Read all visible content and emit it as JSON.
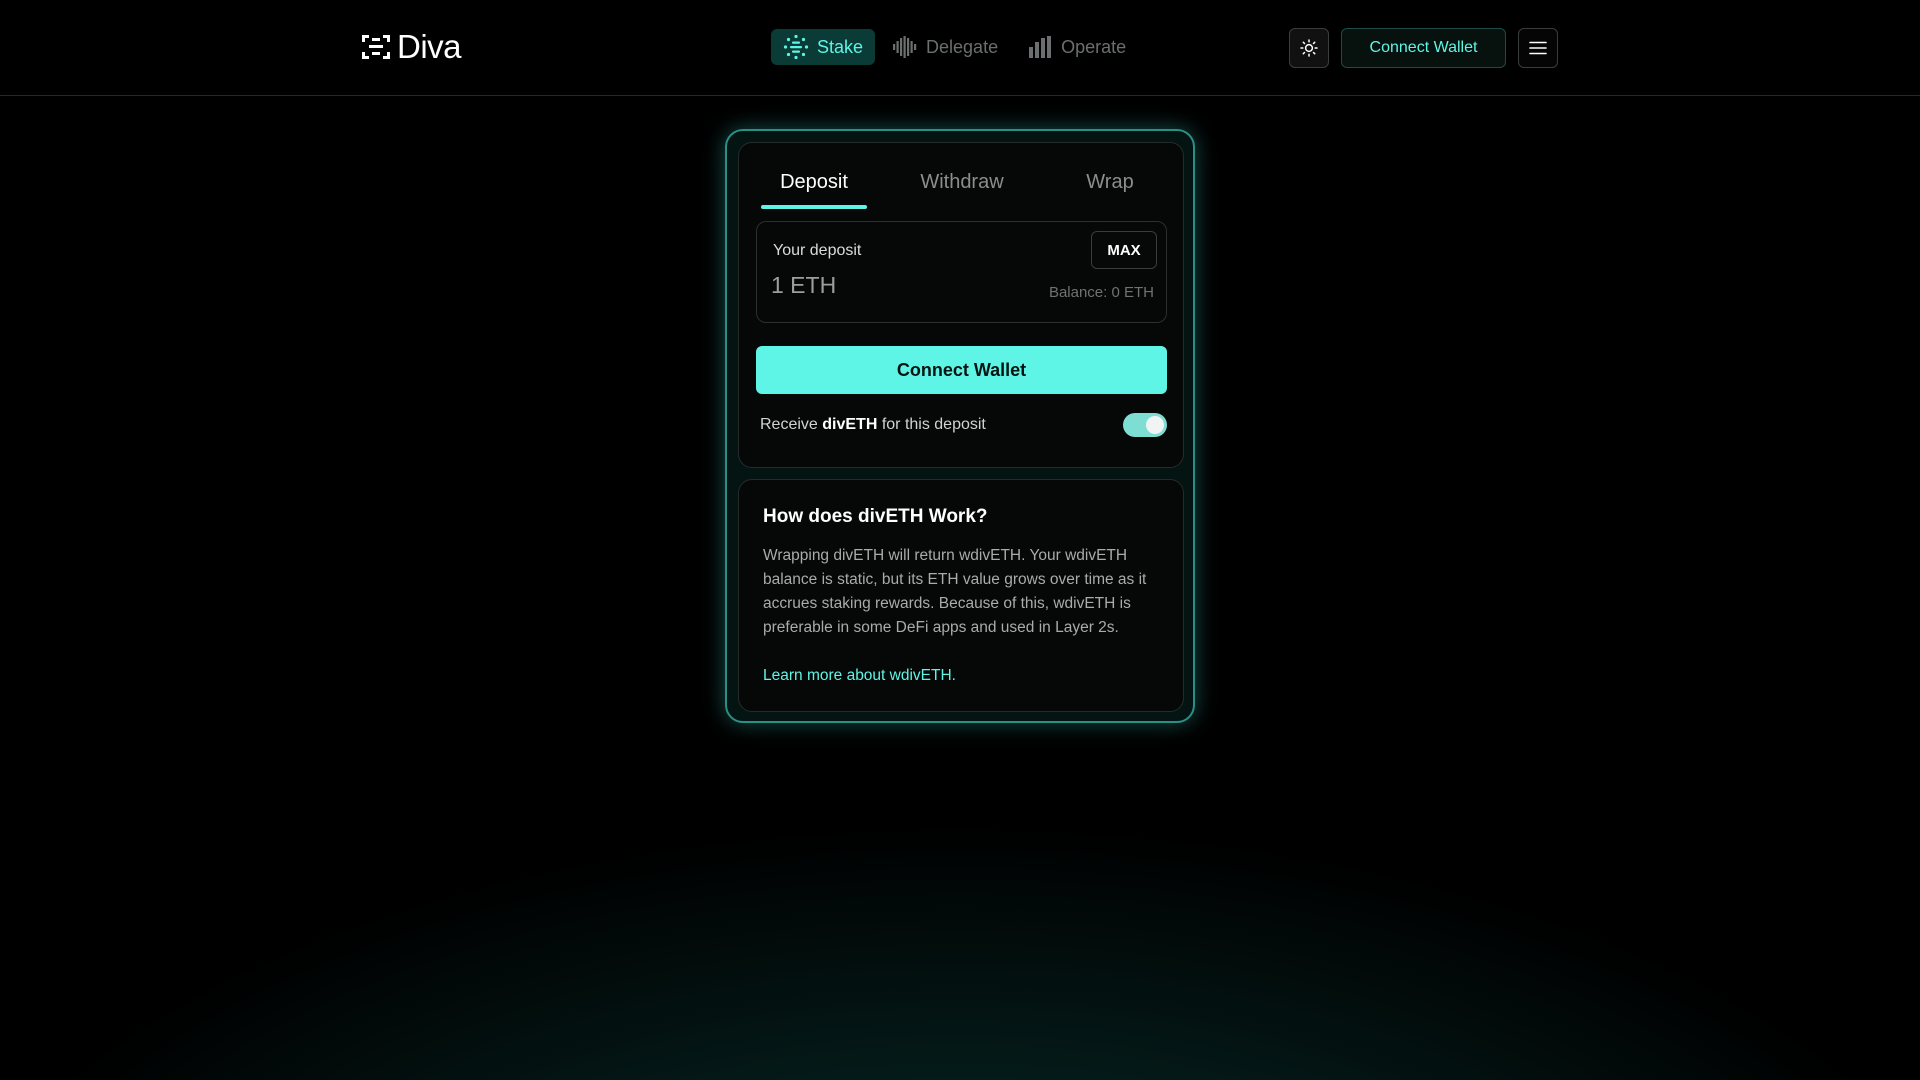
{
  "header": {
    "logo_text": "Diva",
    "nav": [
      {
        "label": "Stake",
        "icon": "stake-icon",
        "active": true
      },
      {
        "label": "Delegate",
        "icon": "delegate-icon",
        "active": false
      },
      {
        "label": "Operate",
        "icon": "operate-icon",
        "active": false
      }
    ],
    "connect_wallet_label": "Connect Wallet",
    "theme_icon": "sun-icon",
    "menu_icon": "hamburger-menu-icon"
  },
  "card": {
    "tabs": [
      {
        "label": "Deposit",
        "active": true
      },
      {
        "label": "Withdraw",
        "active": false
      },
      {
        "label": "Wrap",
        "active": false
      }
    ],
    "deposit": {
      "label": "Your deposit",
      "placeholder": "1 ETH",
      "value": "",
      "max_label": "MAX",
      "balance": "Balance: 0 ETH"
    },
    "connect_wallet_label": "Connect Wallet",
    "receive": {
      "prefix": "Receive ",
      "token": "divETH",
      "suffix": " for this deposit",
      "enabled": true
    }
  },
  "info": {
    "title": "How does divETH Work?",
    "body": "Wrapping divETH will return wdivETH. Your wdivETH balance is static, but its ETH value grows over time as it accrues staking rewards. Because of this, wdivETH is preferable in some DeFi apps and used in Layer 2s.",
    "link": "Learn more about wdivETH."
  },
  "colors": {
    "accent": "#5ff5e6",
    "background": "#000000",
    "card_border": "#2a8f85",
    "nav_active_bg": "#0b3b36"
  }
}
